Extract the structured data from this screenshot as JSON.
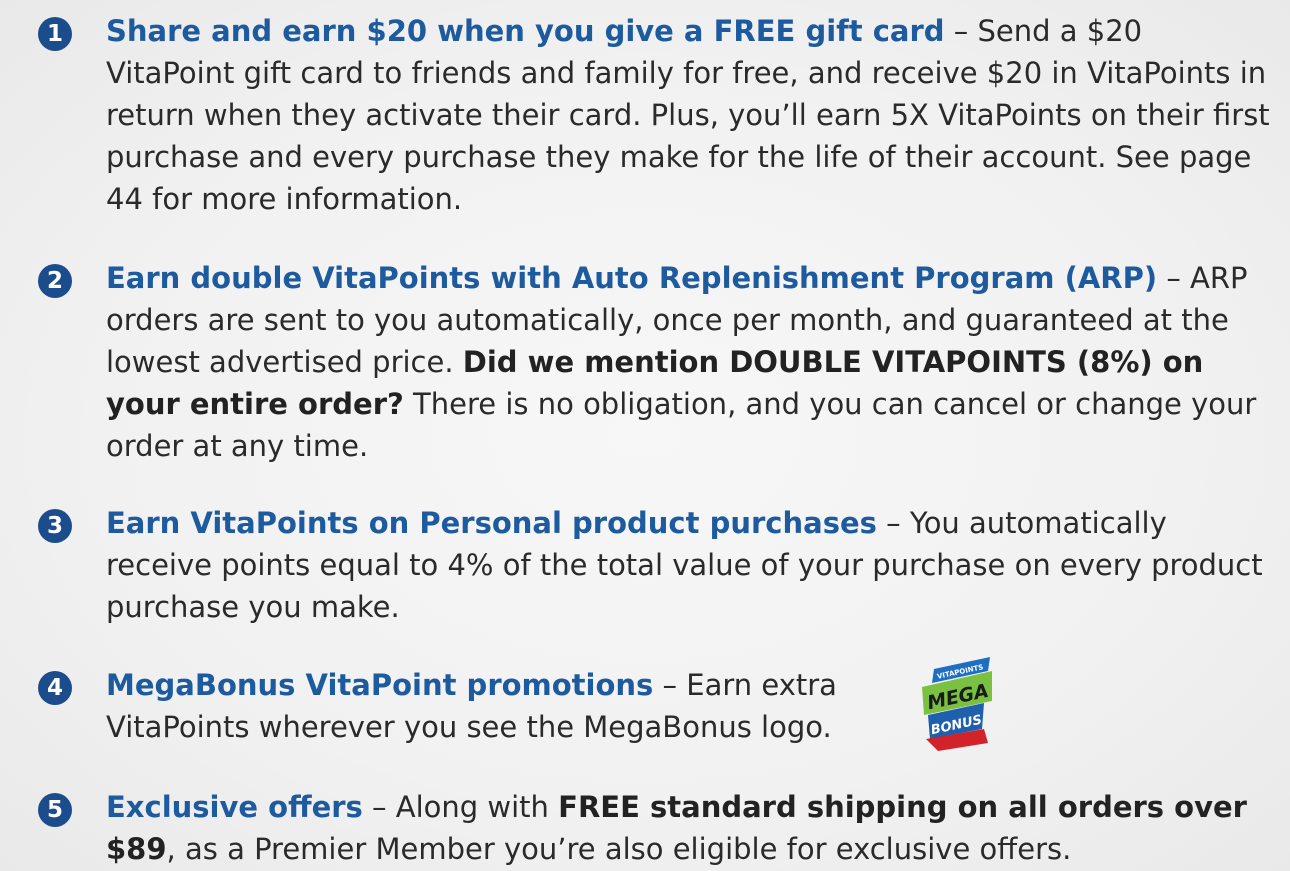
{
  "items": [
    {
      "number": "1",
      "title": "Share and earn $20 when you give a FREE gift card",
      "text": " – Send a $20 VitaPoint gift card to friends and family for free, and receive $20 in VitaPoints in return when they activate their card. Plus, you’ll earn 5X VitaPoints on their first purchase and every purchase they make for the life of their account. See page 44 for more information."
    },
    {
      "number": "2",
      "title": "Earn double VitaPoints with Auto Replenishment Program (ARP)",
      "text_a": " – ARP orders are sent to you automatically, once per month, and guaranteed at the lowest advertised price. ",
      "strong": "Did we mention DOUBLE VITAPOINTS (8%) on your entire order?",
      "text_b": " There is no obligation, and you can cancel or change your order at any time."
    },
    {
      "number": "3",
      "title": "Earn VitaPoints on Personal product purchases",
      "text": "  – You automatically receive points equal to 4% of the total value of your purchase on every product purchase you make."
    },
    {
      "number": "4",
      "title": "MegaBonus VitaPoint promotions",
      "text_a": " – Earn extra",
      "text_b": "VitaPoints wherever you see the MegaBonus logo."
    },
    {
      "number": "5",
      "title": "Exclusive offers",
      "text_a": " – Along with ",
      "strong": "FREE standard shipping on all orders over $89",
      "text_b": ", as a Premier Member you’re also eligible for exclusive offers."
    }
  ],
  "logo": {
    "top_text": "VITAPOINTS",
    "main_text": "MEGA",
    "bottom_text": "BONUS"
  }
}
